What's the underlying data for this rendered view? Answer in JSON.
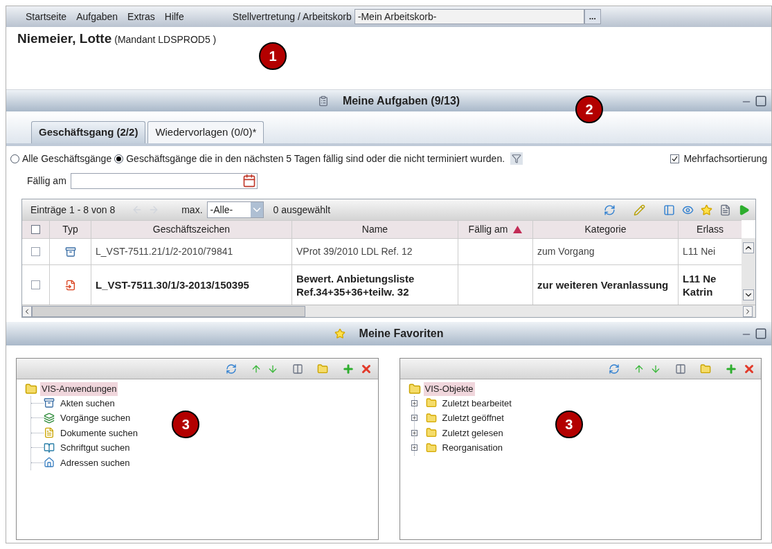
{
  "menu": [
    {
      "label": "Startseite"
    },
    {
      "label": "Aufgaben"
    },
    {
      "label": "Extras"
    },
    {
      "label": "Hilfe"
    }
  ],
  "substitute": {
    "label": "Stellvertretung / Arbeitskorb",
    "value": "-Mein Arbeitskorb-",
    "button": "..."
  },
  "header": {
    "name": "Niemeier, Lotte",
    "client": "(Mandant LDSPROD5 )",
    "marker": "1"
  },
  "tasks": {
    "title": "Meine Aufgaben (9/13)",
    "marker": "2",
    "tabs": [
      {
        "label": "Geschäftsgang (2/2)",
        "selected": true
      },
      {
        "label": "Wiedervorlagen (0/0)*",
        "selected": false
      }
    ],
    "filters": [
      {
        "label": "Alle Geschäftsgänge",
        "selected": false
      },
      {
        "label": "Geschäftsgänge die in den nächsten 5 Tagen fällig sind oder die nicht terminiert wurden.",
        "selected": true
      }
    ],
    "multi_sort": {
      "label": "Mehrfachsortierung",
      "checked": true
    },
    "due_field": {
      "label": "Fällig am"
    },
    "table": {
      "entries": "Einträge 1 - 8 von 8",
      "max_label": "max.",
      "max_value": "-Alle-",
      "selected_count": "0 ausgewählt",
      "select_all": {
        "checked": false
      },
      "columns": [
        {
          "label": "Typ",
          "sorted": false
        },
        {
          "label": "Geschäftszeichen",
          "sorted": false
        },
        {
          "label": "Name",
          "sorted": false
        },
        {
          "label": "Fällig am",
          "sorted": true
        },
        {
          "label": "Kategorie",
          "sorted": false
        },
        {
          "label": "Erlass",
          "sorted": false
        }
      ],
      "rows": [
        {
          "checked": false,
          "kind": "file",
          "unread": false,
          "cells": [
            "",
            "L_VST-7511.21/1/2-2010/79841",
            "VProt 39/2010 LDL Ref. 12",
            "",
            "zum Vorgang",
            "L11 Nei"
          ]
        },
        {
          "checked": false,
          "kind": "forward",
          "unread": true,
          "cells": [
            "",
            "L_VST-7511.30/1/3-2013/150395",
            "Bewert. Anbietungsliste Ref.34+35+36+teilw. 32",
            "",
            "zur weiteren Veranlassung",
            "L11 Ne Katrin"
          ]
        }
      ]
    }
  },
  "favorites": {
    "title": "Meine Favoriten",
    "panels": [
      {
        "marker": "3",
        "root": {
          "label": "VIS-Anwendungen",
          "selected": true,
          "children": [
            {
              "label": "Akten suchen",
              "kind": "file"
            },
            {
              "label": "Vorgänge suchen",
              "kind": "process"
            },
            {
              "label": "Dokumente suchen",
              "kind": "document"
            },
            {
              "label": "Schriftgut suchen",
              "kind": "records"
            },
            {
              "label": "Adressen suchen",
              "kind": "address"
            }
          ]
        }
      },
      {
        "marker": "3",
        "root": {
          "label": "VIS-Objekte",
          "selected": true,
          "children": [
            {
              "label": "Zuletzt bearbeitet",
              "kind": "folder",
              "expanded": false
            },
            {
              "label": "Zuletzt geöffnet",
              "kind": "folder",
              "expanded": false
            },
            {
              "label": "Zuletzt gelesen",
              "kind": "folder",
              "expanded": false
            },
            {
              "label": "Reorganisation",
              "kind": "folder",
              "expanded": false
            }
          ]
        }
      }
    ]
  }
}
